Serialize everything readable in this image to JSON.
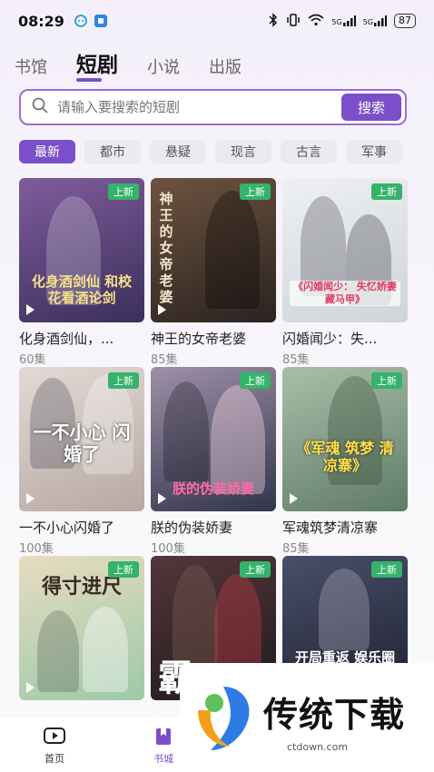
{
  "status": {
    "time": "08:29",
    "battery": "87",
    "net1": "5G",
    "net2": "5G"
  },
  "tabs": [
    "书馆",
    "短剧",
    "小说",
    "出版"
  ],
  "search": {
    "placeholder": "请输入要搜索的短剧",
    "button": "搜索"
  },
  "chips": [
    "最新",
    "都市",
    "悬疑",
    "现言",
    "古言",
    "军事"
  ],
  "cards": [
    {
      "title": "化身酒剑仙，...",
      "count": "60集",
      "badge": "上新",
      "poster_text": "化身酒剑仙 和校花看酒论剑",
      "colors": [
        "#3b2f5a",
        "#7f5c9c"
      ],
      "text_color": "#f6e08a"
    },
    {
      "title": "神王的女帝老婆",
      "count": "85集",
      "badge": "上新",
      "poster_text": "神王的女帝老婆",
      "colors": [
        "#2b2320",
        "#6d5340"
      ],
      "text_color": "#f2e6c8"
    },
    {
      "title": "闪婚闻少：失...",
      "count": "85集",
      "badge": "上新",
      "poster_text": "《闪婚闻少： 失忆娇妻藏马甲》",
      "colors": [
        "#cfd4da",
        "#eef0f2"
      ],
      "text_color": "#e03a5e"
    },
    {
      "title": "一不小心闪婚了",
      "count": "100集",
      "badge": "上新",
      "poster_text": "一不小心 闪婚了",
      "colors": [
        "#b7a8a2",
        "#e3dad5"
      ],
      "text_color": "#ffffff"
    },
    {
      "title": "朕的伪装娇妻",
      "count": "100集",
      "badge": "上新",
      "poster_text": "朕的伪装娇妻",
      "colors": [
        "#32344a",
        "#9e90a8"
      ],
      "text_color": "#ff6aa6"
    },
    {
      "title": "军魂筑梦清凉寨",
      "count": "85集",
      "badge": "上新",
      "poster_text": "《军魂 筑梦 清凉寨》",
      "colors": [
        "#5f7c68",
        "#a9bfa9"
      ],
      "text_color": "#ffe14a"
    },
    {
      "title": "",
      "count": "",
      "badge": "上新",
      "poster_text": "得寸进尺",
      "colors": [
        "#9cc9a9",
        "#e8dcc0"
      ],
      "text_color": "#3a2a22"
    },
    {
      "title": "",
      "count": "",
      "badge": "上新",
      "poster_text": "霸",
      "colors": [
        "#1f1a1d",
        "#54363c"
      ],
      "text_color": "#ffffff"
    },
    {
      "title": "",
      "count": "",
      "badge": "上新",
      "poster_text": "开局重返 娱乐圈",
      "colors": [
        "#1e2130",
        "#4a4f6a"
      ],
      "text_color": "#ffffff"
    }
  ],
  "nav": [
    {
      "label": "首页",
      "icon": "video-play-icon"
    },
    {
      "label": "书城",
      "icon": "bookmark-icon"
    }
  ],
  "watermark": {
    "text": "传统下载",
    "url": "ctdown.com"
  },
  "theme": {
    "accent": "#7b4fc9",
    "badge": "#34b36a"
  }
}
